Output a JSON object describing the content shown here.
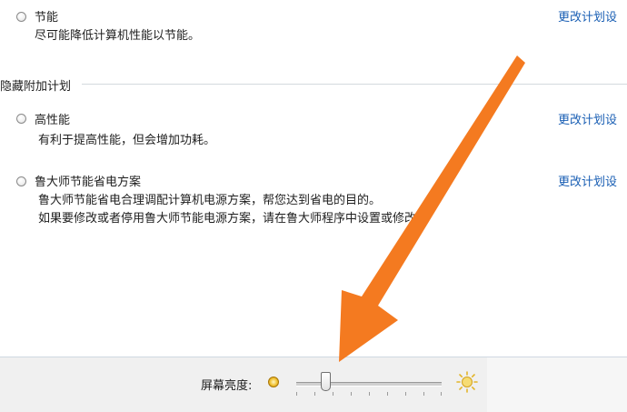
{
  "plans": [
    {
      "name": "节能",
      "description": "尽可能降低计算机性能以节能。",
      "link": "更改计划设"
    }
  ],
  "hidden_group": {
    "title": "隐藏附加计划",
    "plans": [
      {
        "name": "高性能",
        "description": "有利于提高性能，但会增加功耗。",
        "link": "更改计划设"
      },
      {
        "name": "鲁大师节能省电方案",
        "description_line1": "鲁大师节能省电合理调配计算机电源方案，帮您达到省电的目的。",
        "description_line2": "如果要修改或者停用鲁大师节能电源方案，请在鲁大师程序中设置或修改。",
        "link": "更改计划设"
      }
    ]
  },
  "footer": {
    "brightness_label": "屏幕亮度:",
    "brightness_level_fraction": 0.2,
    "dim_icon": "dim-sun-icon",
    "bright_icon": "bright-sun-icon"
  },
  "overlay": {
    "arrow_color": "#f47a20",
    "arrow_icon": "annotation-arrow"
  }
}
